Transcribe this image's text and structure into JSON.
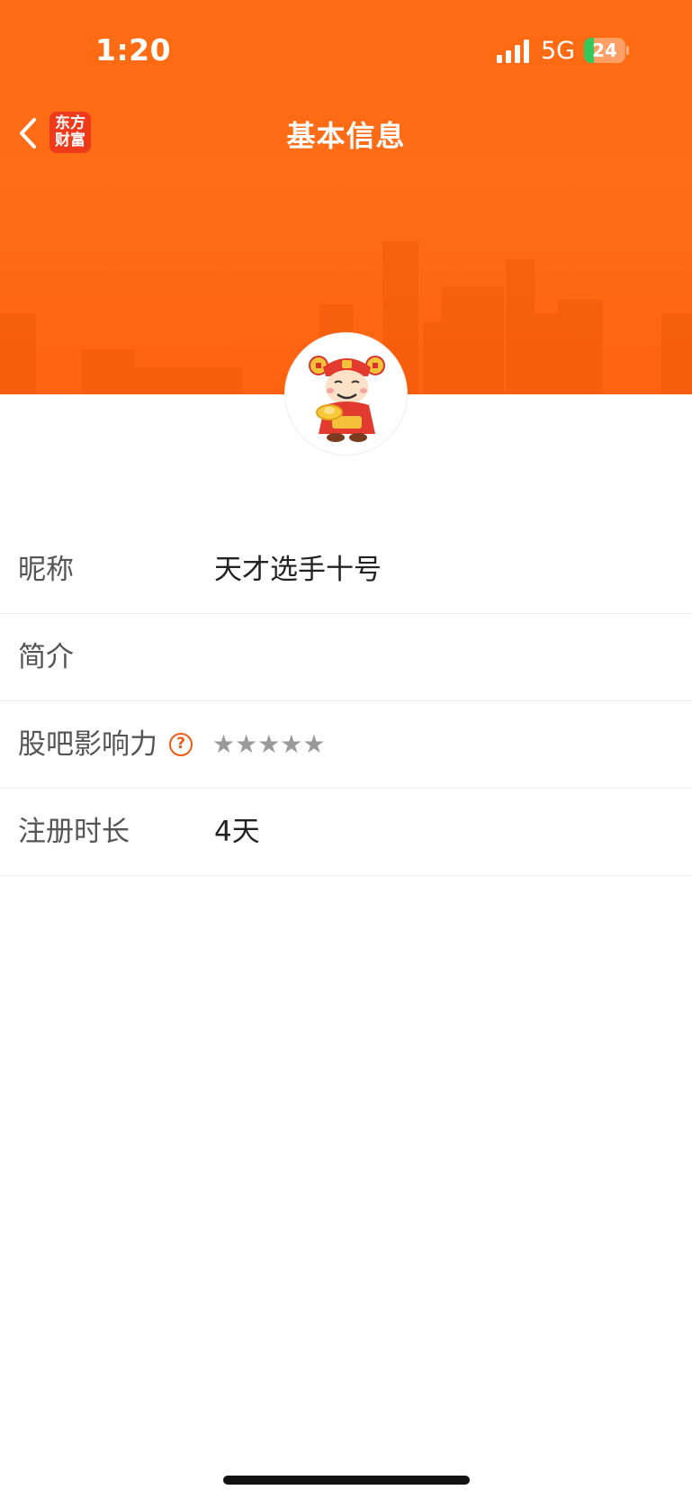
{
  "status_bar": {
    "time": "1:20",
    "network_type": "5G",
    "battery_level": "24",
    "battery_fraction": 0.24
  },
  "nav": {
    "title": "基本信息",
    "app_logo_text": "东方财富"
  },
  "profile": {
    "rows": [
      {
        "label": "昵称",
        "value": "天才选手十号"
      },
      {
        "label": "简介",
        "value": ""
      },
      {
        "label": "股吧影响力",
        "stars": "★★★★★",
        "help_icon": "?"
      },
      {
        "label": "注册时长",
        "value": "4天"
      }
    ]
  },
  "colors": {
    "brand_orange": "#ff6a12",
    "help_icon": "#f05a13",
    "star_gray": "#9a9a9a"
  }
}
